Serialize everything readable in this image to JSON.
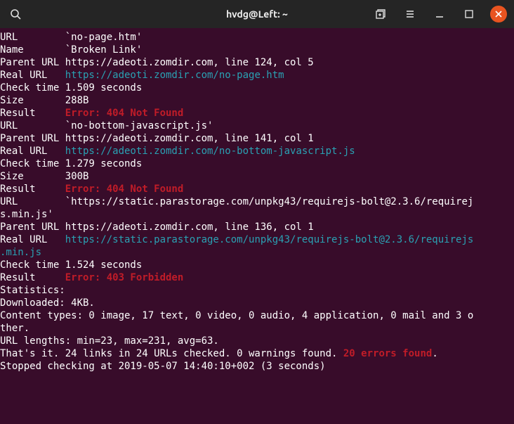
{
  "window": {
    "title": "hvdg@Left: ~"
  },
  "entries": [
    {
      "url_label": "URL",
      "url_value": "`no-page.htm'",
      "name_label": "Name",
      "name_value": "`Broken Link'",
      "parent_label": "Parent URL",
      "parent_value": "https://adeoti.zomdir.com, line 124, col 5",
      "real_label": "Real URL",
      "real_value": "https://adeoti.zomdir.com/no-page.htm",
      "check_label": "Check time",
      "check_value": "1.509 seconds",
      "size_label": "Size",
      "size_value": "288B",
      "result_label": "Result",
      "result_value": "Error: 404 Not Found"
    },
    {
      "url_label": "URL",
      "url_value": "`no-bottom-javascript.js'",
      "parent_label": "Parent URL",
      "parent_value": "https://adeoti.zomdir.com, line 141, col 1",
      "real_label": "Real URL",
      "real_value": "https://adeoti.zomdir.com/no-bottom-javascript.js",
      "check_label": "Check time",
      "check_value": "1.279 seconds",
      "size_label": "Size",
      "size_value": "300B",
      "result_label": "Result",
      "result_value": "Error: 404 Not Found"
    },
    {
      "url_label": "URL",
      "url_value_l1": "`https://static.parastorage.com/unpkg43/requirejs-bolt@2.3.6/requirej",
      "url_value_l2": "s.min.js'",
      "parent_label": "Parent URL",
      "parent_value": "https://adeoti.zomdir.com, line 136, col 1",
      "real_label": "Real URL",
      "real_value_l1": "https://static.parastorage.com/unpkg43/requirejs-bolt@2.3.6/requirejs",
      "real_value_l2": ".min.js",
      "check_label": "Check time",
      "check_value": "1.524 seconds",
      "result_label": "Result",
      "result_value": "Error: 403 Forbidden"
    }
  ],
  "stats": {
    "heading": "Statistics:",
    "downloaded": "Downloaded: 4KB.",
    "content_types_l1": "Content types: 0 image, 17 text, 0 video, 0 audio, 4 application, 0 mail and 3 o",
    "content_types_l2": "ther.",
    "url_lengths": "URL lengths: min=23, max=231, avg=63."
  },
  "summary": {
    "line1_a": "That's it. 24 links in 24 URLs checked. 0 warnings found. ",
    "line1_err": "20 errors found",
    "line1_b": ".",
    "line2": "Stopped checking at 2019-05-07 14:40:10+002 (3 seconds)"
  },
  "padw": 11
}
